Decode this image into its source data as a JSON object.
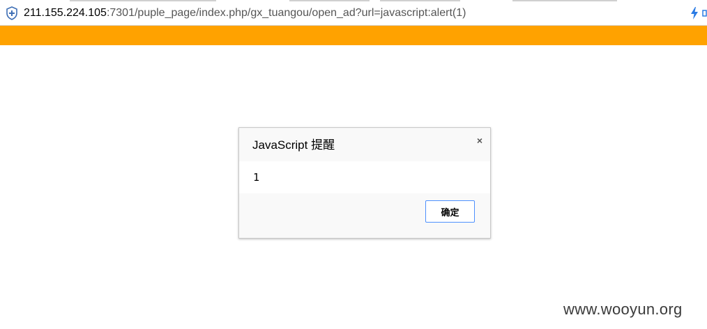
{
  "browser": {
    "url_host": "211.155.224.105",
    "url_rest": ":7301/puple_page/index.php/gx_tuangou/open_ad?url=javascript:alert(1)",
    "icons": {
      "security": "shield-icon",
      "accelerate": "bolt-icon",
      "extension": "edge-icon"
    }
  },
  "page": {
    "banner_color": "#ffa200"
  },
  "alert_dialog": {
    "title": "JavaScript 提醒",
    "message": "1",
    "ok_label": "确定",
    "close_icon": "close-icon",
    "close_glyph": "×"
  },
  "watermark": {
    "text": "www.wooyun.org"
  }
}
